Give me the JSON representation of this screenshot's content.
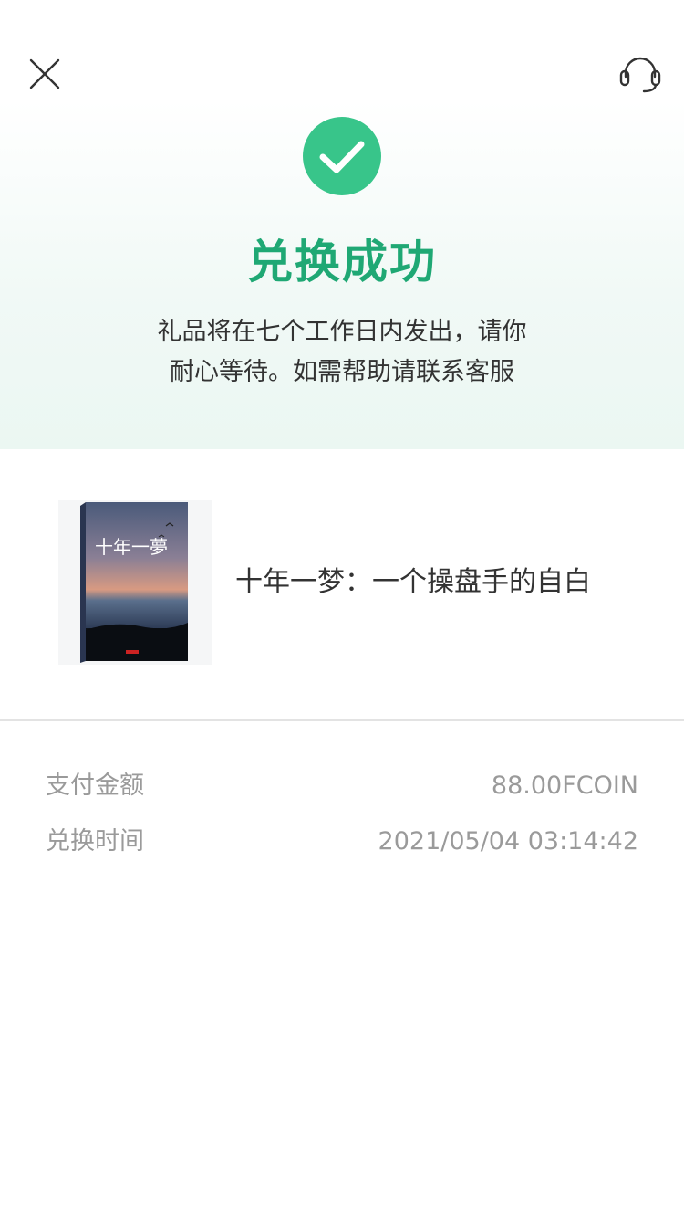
{
  "header": {
    "close_icon": "close-icon",
    "support_icon": "headset-icon"
  },
  "status": {
    "icon": "check-circle-icon",
    "title": "兑换成功",
    "description_line1": "礼品将在七个工作日内发出，请你",
    "description_line2": "耐心等待。如需帮助请联系客服",
    "accent_color": "#38c58a",
    "title_color": "#1fa874"
  },
  "product": {
    "name": "十年一梦：一个操盘手的自白",
    "cover_title": "十年一夢"
  },
  "details": {
    "payment_label": "支付金额",
    "payment_value": "88.00FCOIN",
    "time_label": "兑换时间",
    "time_value": "2021/05/04 03:14:42"
  }
}
